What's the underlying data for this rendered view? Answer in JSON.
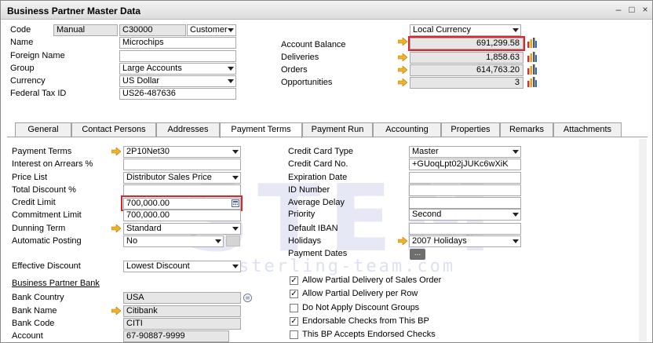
{
  "window": {
    "title": "Business Partner Master Data"
  },
  "header": {
    "code_label": "Code",
    "code_series": "Manual",
    "code_value": "C30000",
    "code_type": "Customer",
    "name_label": "Name",
    "name_value": "Microchips",
    "foreign_name_label": "Foreign Name",
    "foreign_name_value": "",
    "group_label": "Group",
    "group_value": "Large Accounts",
    "currency_label": "Currency",
    "currency_value": "US Dollar",
    "federal_tax_label": "Federal Tax ID",
    "federal_tax_value": "US26-487636",
    "local_currency": "Local Currency",
    "account_balance_label": "Account Balance",
    "account_balance_value": "691,299.58",
    "deliveries_label": "Deliveries",
    "deliveries_value": "1,858.63",
    "orders_label": "Orders",
    "orders_value": "614,763.20",
    "opportunities_label": "Opportunities",
    "opportunities_value": "3"
  },
  "tabs": [
    {
      "label": "General"
    },
    {
      "label": "Contact Persons"
    },
    {
      "label": "Addresses"
    },
    {
      "label": "Payment Terms"
    },
    {
      "label": "Payment Run"
    },
    {
      "label": "Accounting"
    },
    {
      "label": "Properties"
    },
    {
      "label": "Remarks"
    },
    {
      "label": "Attachments"
    }
  ],
  "payment_terms": {
    "payment_terms_label": "Payment Terms",
    "payment_terms_value": "2P10Net30",
    "interest_label": "Interest on Arrears %",
    "interest_value": "",
    "price_list_label": "Price List",
    "price_list_value": "Distributor Sales Price",
    "total_discount_label": "Total Discount %",
    "total_discount_value": "",
    "credit_limit_label": "Credit Limit",
    "credit_limit_value": "700,000.00",
    "commitment_limit_label": "Commitment Limit",
    "commitment_limit_value": "700,000.00",
    "dunning_term_label": "Dunning Term",
    "dunning_term_value": "Standard",
    "automatic_posting_label": "Automatic Posting",
    "automatic_posting_value": "No",
    "effective_discount_label": "Effective Discount",
    "effective_discount_value": "Lowest Discount",
    "bp_bank_label": "Business Partner Bank",
    "bank_country_label": "Bank Country",
    "bank_country_value": "USA",
    "bank_name_label": "Bank Name",
    "bank_name_value": "Citibank",
    "bank_code_label": "Bank Code",
    "bank_code_value": "CITI",
    "account_label": "Account",
    "account_value": "67-90887-9999",
    "cc_type_label": "Credit Card Type",
    "cc_type_value": "Master",
    "cc_no_label": "Credit Card  No.",
    "cc_no_value": "+GUoqLpt02jJUKc6wXiK",
    "expiration_label": "Expiration Date",
    "expiration_value": "",
    "id_number_label": "ID Number",
    "id_number_value": "",
    "avg_delay_label": "Average Delay",
    "avg_delay_value": "",
    "priority_label": "Priority",
    "priority_value": "Second",
    "default_iban_label": "Default IBAN",
    "default_iban_value": "",
    "holidays_label": "Holidays",
    "holidays_value": "2007 Holidays",
    "payment_dates_label": "Payment Dates",
    "payment_dates_btn": "...",
    "checks": [
      {
        "label": "Allow Partial Delivery of Sales Order",
        "checked": true
      },
      {
        "label": "Allow Partial Delivery per Row",
        "checked": true
      },
      {
        "label": "Do Not Apply Discount Groups",
        "checked": false
      },
      {
        "label": "Endorsable Checks from This BP",
        "checked": true
      },
      {
        "label": "This BP Accepts Endorsed Checks",
        "checked": false
      }
    ]
  },
  "watermark": {
    "text": "STEM",
    "sub": "www.sterling-team.com",
    "reg": "®"
  },
  "colors": {
    "highlight": "#d9262d",
    "arrow": "#f0b323",
    "readonly": "#e6e6e6"
  }
}
